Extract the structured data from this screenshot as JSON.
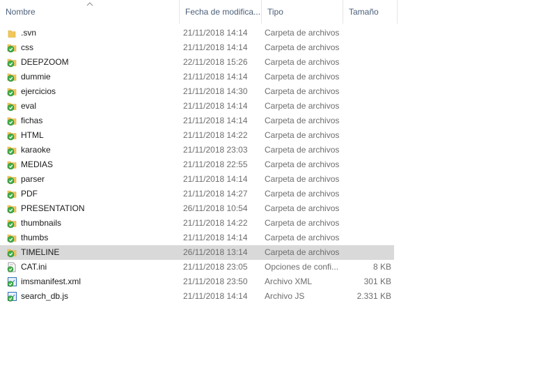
{
  "columns": {
    "name": "Nombre",
    "date": "Fecha de modifica...",
    "type": "Tipo",
    "size": "Tamaño"
  },
  "colors": {
    "folder": "#f1c75a",
    "svn_ok": "#3fae49",
    "selected_row": "#d9d9d9",
    "header_text": "#4c607a"
  },
  "files": [
    {
      "name": ".svn",
      "date": "21/11/2018 14:14",
      "type": "Carpeta de archivos",
      "size": "",
      "icon": "folder-icon"
    },
    {
      "name": "css",
      "date": "21/11/2018 14:14",
      "type": "Carpeta de archivos",
      "size": "",
      "icon": "svn-folder-icon"
    },
    {
      "name": "DEEPZOOM",
      "date": "22/11/2018 15:26",
      "type": "Carpeta de archivos",
      "size": "",
      "icon": "svn-folder-icon"
    },
    {
      "name": "dummie",
      "date": "21/11/2018 14:14",
      "type": "Carpeta de archivos",
      "size": "",
      "icon": "svn-folder-icon"
    },
    {
      "name": "ejercicios",
      "date": "21/11/2018 14:30",
      "type": "Carpeta de archivos",
      "size": "",
      "icon": "svn-folder-icon"
    },
    {
      "name": "eval",
      "date": "21/11/2018 14:14",
      "type": "Carpeta de archivos",
      "size": "",
      "icon": "svn-folder-icon"
    },
    {
      "name": "fichas",
      "date": "21/11/2018 14:14",
      "type": "Carpeta de archivos",
      "size": "",
      "icon": "svn-folder-icon"
    },
    {
      "name": "HTML",
      "date": "21/11/2018 14:22",
      "type": "Carpeta de archivos",
      "size": "",
      "icon": "svn-folder-icon"
    },
    {
      "name": "karaoke",
      "date": "21/11/2018 23:03",
      "type": "Carpeta de archivos",
      "size": "",
      "icon": "svn-folder-icon"
    },
    {
      "name": "MEDIAS",
      "date": "21/11/2018 22:55",
      "type": "Carpeta de archivos",
      "size": "",
      "icon": "svn-folder-icon"
    },
    {
      "name": "parser",
      "date": "21/11/2018 14:14",
      "type": "Carpeta de archivos",
      "size": "",
      "icon": "svn-folder-icon"
    },
    {
      "name": "PDF",
      "date": "21/11/2018 14:27",
      "type": "Carpeta de archivos",
      "size": "",
      "icon": "svn-folder-icon"
    },
    {
      "name": "PRESENTATION",
      "date": "26/11/2018 10:54",
      "type": "Carpeta de archivos",
      "size": "",
      "icon": "svn-folder-icon"
    },
    {
      "name": "thumbnails",
      "date": "21/11/2018 14:22",
      "type": "Carpeta de archivos",
      "size": "",
      "icon": "svn-folder-icon"
    },
    {
      "name": "thumbs",
      "date": "21/11/2018 14:14",
      "type": "Carpeta de archivos",
      "size": "",
      "icon": "svn-folder-icon"
    },
    {
      "name": "TIMELINE",
      "date": "26/11/2018 13:14",
      "type": "Carpeta de archivos",
      "size": "",
      "icon": "svn-folder-icon",
      "selected": true
    },
    {
      "name": "CAT.ini",
      "date": "21/11/2018 23:05",
      "type": "Opciones de confi...",
      "size": "8 KB",
      "icon": "svn-file-icon"
    },
    {
      "name": "imsmanifest.xml",
      "date": "21/11/2018 23:50",
      "type": "Archivo XML",
      "size": "301 KB",
      "icon": "svn-image-file-icon"
    },
    {
      "name": "search_db.js",
      "date": "21/11/2018 14:14",
      "type": "Archivo JS",
      "size": "2.331 KB",
      "icon": "svn-image-file-icon"
    }
  ]
}
